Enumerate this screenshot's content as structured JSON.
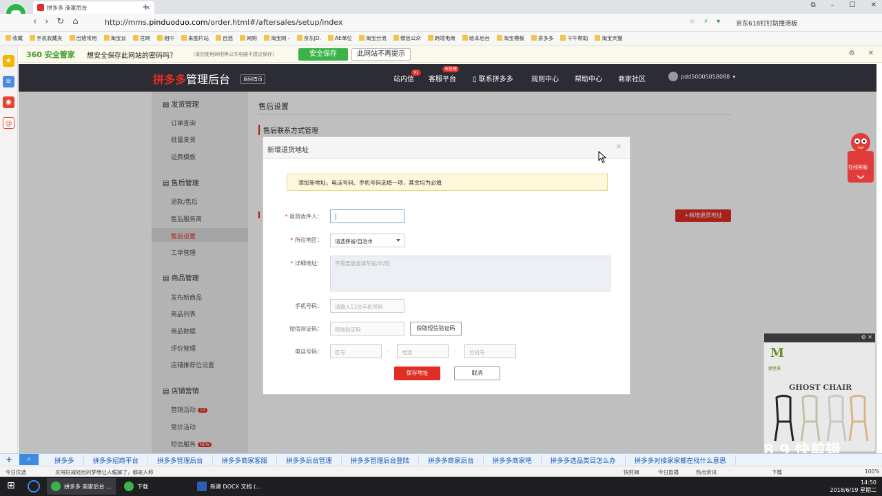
{
  "browser": {
    "tab_title": "拼多多 商家后台",
    "url_prefix": "http://mms.",
    "url_domain": "pinduoduo.com",
    "url_path": "/order.html#/aftersales/setup/index",
    "right_text": "京东618钉钉防撞滑板",
    "bookmarks": [
      "收藏",
      "手机收藏夹",
      "出错常用",
      "淘宝云",
      "官网",
      "相中",
      "来图片站",
      "自选",
      "网购",
      "淘宝网 -",
      "京东JD.",
      "AE单位",
      "淘宝分流",
      "微信公众",
      "跨境电商",
      "绘本后台",
      "淘宝模板",
      "拼多多",
      "千牛帮助",
      "淘宝天猫"
    ]
  },
  "safebar": {
    "logo": "360 安全管家",
    "question": "想安全保存此网站的密码吗？",
    "hint": "（请勿使用网吧等公共电脑不建议保存）",
    "save_btn": "安全保存",
    "no_prompt_btn": "此网站不再提示"
  },
  "header": {
    "brand": "拼多多",
    "brand_suffix": "管理后台",
    "back_home": "返回首页",
    "nav": [
      "站内信",
      "客服平台",
      "联系拼多多",
      "规则中心",
      "帮助中心",
      "商家社区"
    ],
    "msg_badge": "91",
    "service_badge": "去处理",
    "username": "pdd50005058088"
  },
  "sidebar": {
    "groups": [
      {
        "title": "发货管理",
        "items": [
          "订单查询",
          "批量发货",
          "运费模板"
        ]
      },
      {
        "title": "售后管理",
        "items": [
          "退款/售后",
          "售后服务商",
          "售后设置",
          "工单管理"
        ]
      },
      {
        "title": "商品管理",
        "items": [
          "发布新商品",
          "商品列表",
          "商品数据",
          "评价管理",
          "店铺推荐位设置"
        ]
      },
      {
        "title": "店铺营销",
        "items": [
          "营销活动",
          "竞价活动",
          "短信服务"
        ]
      }
    ],
    "marketing_badge": "19",
    "sms_badge": "NEW"
  },
  "content": {
    "title": "售后设置",
    "section": "售后联系方式管理",
    "add_return_btn": "+新增退货地址"
  },
  "modal": {
    "title": "新增退货地址",
    "notice": "添加新地址，电话号码、手机号码选填一项，其余均为必填",
    "labels": {
      "receiver": "退货收件人：",
      "region": "所在地区：",
      "detail": "详细地址：",
      "phone": "手机号码：",
      "code": "短信验证码：",
      "tel": "电话号码："
    },
    "receiver_value": "|",
    "region_value": "请选择省/自治市",
    "detail_placeholder": "不需要重复填写省/市/区",
    "phone_placeholder": "请输入11位手机号码",
    "code_placeholder": "短信验证码",
    "get_code_btn": "获取短信验证码",
    "area_placeholder": "区号",
    "tel_placeholder": "电话",
    "ext_placeholder": "分机号",
    "save_btn": "保存地址",
    "cancel_btn": "取消"
  },
  "widget": {
    "service": "在线客服"
  },
  "ad": {
    "title": "GHOST CHAIR",
    "brand": "M",
    "brand_name": "摩登雅"
  },
  "watermark": "8 9 快剪辑",
  "searchbar": {
    "links": [
      "拼多多",
      "拼多多招商平台",
      "拼多多管理后台",
      "拼多多商家客服",
      "拼多多后台管理",
      "拼多多管理后台登陆",
      "拼多多商家后台",
      "拼多多商家吧",
      "拼多多选品类目怎么办",
      "拼多多对接家家都在找什么意思"
    ]
  },
  "statusbar": {
    "left": "今日优选",
    "news": "买得好减轻后的梦想让人缓解了，都是人称",
    "right": [
      "快剪辑",
      "今日直播",
      "热点资讯",
      "下载",
      "100%"
    ]
  },
  "taskbar": {
    "tasks": [
      "拼多多 商家后台 ...",
      "下载",
      "新建 DOCX 文档 (..."
    ],
    "time": "14:50",
    "date": "2018/6/19 星期二"
  }
}
